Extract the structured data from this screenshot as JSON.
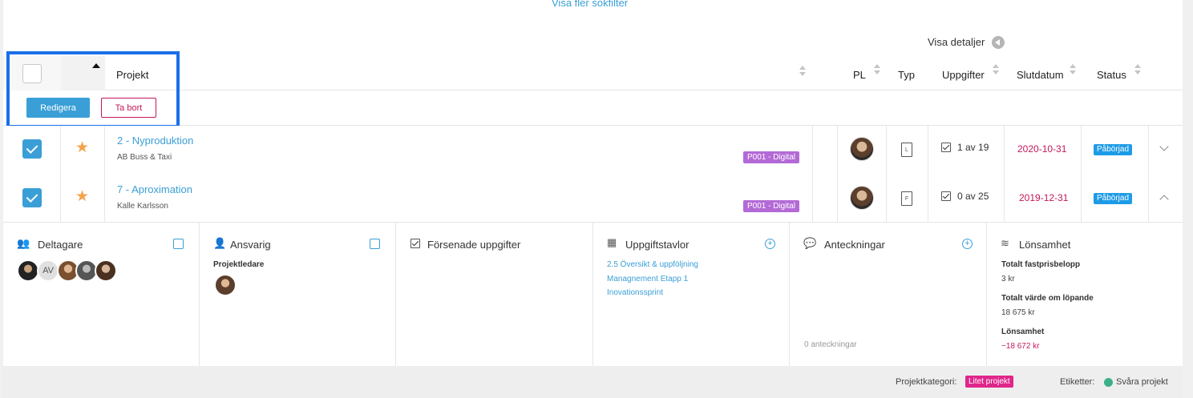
{
  "top": {
    "more_filters": "Visa fler sökfilter",
    "details_toggle": "Visa detaljer"
  },
  "header": {
    "project": "Projekt",
    "pl": "PL",
    "type": "Typ",
    "tasks": "Uppgifter",
    "end_date": "Slutdatum",
    "status": "Status"
  },
  "actions": {
    "edit": "Redigera",
    "delete": "Ta bort"
  },
  "rows": [
    {
      "title": "2 - Nyproduktion",
      "client": "AB Buss & Taxi",
      "tag": "P001 - Digital",
      "type_letter": "L",
      "tasks": "1 av 19",
      "end_date": "2020-10-31",
      "status": "Påbörjad",
      "checked": true,
      "favorite": true,
      "expanded": false
    },
    {
      "title": "7 - Aproximation",
      "client": "Kalle Karlsson",
      "tag": "P001 - Digital",
      "type_letter": "F",
      "tasks": "0 av 25",
      "end_date": "2019-12-31",
      "status": "Påbörjad",
      "checked": true,
      "favorite": true,
      "expanded": true
    }
  ],
  "details": {
    "participants": {
      "title": "Deltagare",
      "initials": "AV"
    },
    "responsible": {
      "title": "Ansvarig",
      "role": "Projektledare"
    },
    "overdue": {
      "title": "Försenade uppgifter"
    },
    "boards": {
      "title": "Uppgiftstavlor",
      "items": [
        "2.5 Översikt & uppföljning",
        "Managnement Etapp 1",
        "Inovationssprint"
      ]
    },
    "notes": {
      "title": "Anteckningar",
      "count": "0 anteckningar"
    },
    "profit": {
      "title": "Lönsamhet",
      "fixed_label": "Totalt fastprisbelopp",
      "fixed_value": "3 kr",
      "running_label": "Totalt värde om löpande",
      "running_value": "18 675 kr",
      "profit_label": "Lönsamhet",
      "profit_value": "−18 672 kr"
    }
  },
  "footer": {
    "category_label": "Projektkategori:",
    "category": "Litet projekt",
    "tags_label": "Etiketter:",
    "tag": "Svåra projekt"
  },
  "colors": {
    "accent": "#3a9fd6",
    "danger": "#c2185b",
    "tag_purple": "#b36ad6",
    "status_blue": "#1e9be6",
    "category_pink": "#e0268a",
    "selection": "#1a6fe8"
  }
}
